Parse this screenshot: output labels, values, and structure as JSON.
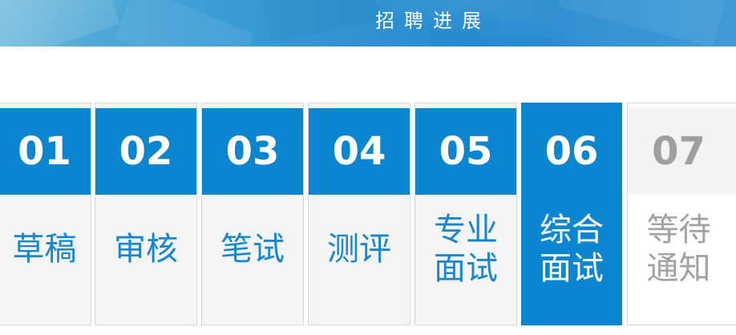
{
  "header": {
    "title": "招聘进展",
    "background_color": "#1a84cc"
  },
  "steps": [
    {
      "number": "01",
      "label_line1": "草稿",
      "label_line2": "",
      "state": "completed"
    },
    {
      "number": "02",
      "label_line1": "审核",
      "label_line2": "",
      "state": "completed"
    },
    {
      "number": "03",
      "label_line1": "笔试",
      "label_line2": "",
      "state": "completed"
    },
    {
      "number": "04",
      "label_line1": "测评",
      "label_line2": "",
      "state": "completed"
    },
    {
      "number": "05",
      "label_line1": "专业",
      "label_line2": "面试",
      "state": "completed"
    },
    {
      "number": "06",
      "label_line1": "综合",
      "label_line2": "面试",
      "state": "current"
    },
    {
      "number": "07",
      "label_line1": "等待",
      "label_line2": "通知",
      "state": "pending"
    }
  ],
  "colors": {
    "accent": "#0a86d1",
    "label_text": "#1587cf",
    "pending_text": "#a2a2a2",
    "card_background": "#f5f5f5"
  }
}
